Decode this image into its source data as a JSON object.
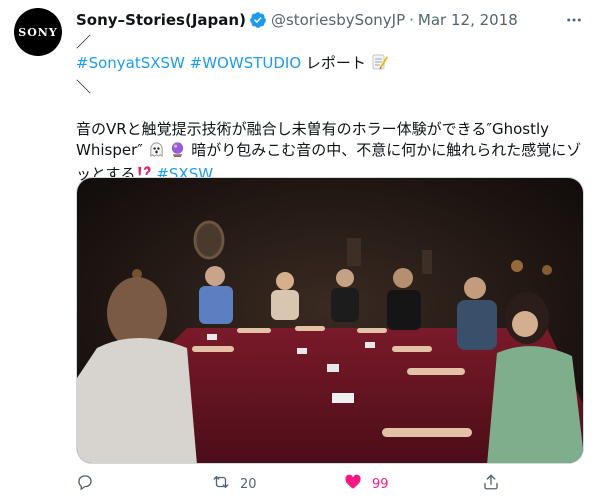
{
  "tweet": {
    "avatar_text": "SONY",
    "display_name": "Sony–Stories(Japan)",
    "handle": "@storiesbySonyJP",
    "separator": "·",
    "date": "Mar 12, 2018",
    "body": {
      "line1": "／",
      "line2_hashtag1": "#SonyatSXSW",
      "line2_hashtag2": "#WOWSTUDIO",
      "line2_text": " レポート",
      "line3": "＼",
      "line5": "音のVRと触覚提示技術が融合し未曽有のホラー体験ができる″Ghostly",
      "line6_text": "Whisper″",
      "line6_rest": "暗がり包みこむ音の中、不意に何かに触れられた感覚にゾ",
      "line7_text": "ッとする",
      "line7_hashtag": "#SXSW"
    },
    "actions": {
      "retweet_count": "20",
      "like_count": "99"
    },
    "colors": {
      "link": "#1d9bf0",
      "like": "#f91880",
      "muted": "#536471",
      "verified": "#1d9bf0"
    }
  }
}
